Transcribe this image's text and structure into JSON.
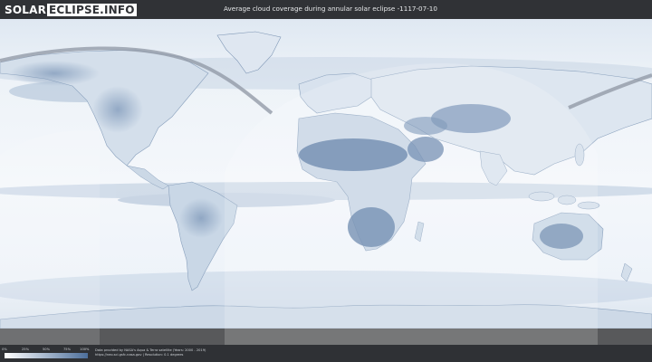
{
  "logo": {
    "left_text": "SOLAR",
    "right_text": "ECLIPSE.INFO"
  },
  "title": "Average cloud coverage during annular solar eclipse -1117-07-10",
  "map": {
    "description_colors": {
      "ocean_light": "#edf3f9",
      "cloud_heavy": "#5f7fa6",
      "cloud_dark": "#4a6790",
      "land_outline": "#8aa1bd",
      "eclipse_path": "#8d96a3"
    }
  },
  "legend": {
    "ticks": [
      "0%",
      "25%",
      "50%",
      "75%",
      "100%"
    ],
    "color_low": "#ffffff",
    "color_high": "#4d6f9b"
  },
  "credits": {
    "line1": "Data provided by NASA's Aqua & Terra satellite (Years: 2000 - 2019)",
    "line2": "https://neo.sci.gsfc.nasa.gov | Resolution: 0.1 degrees"
  }
}
